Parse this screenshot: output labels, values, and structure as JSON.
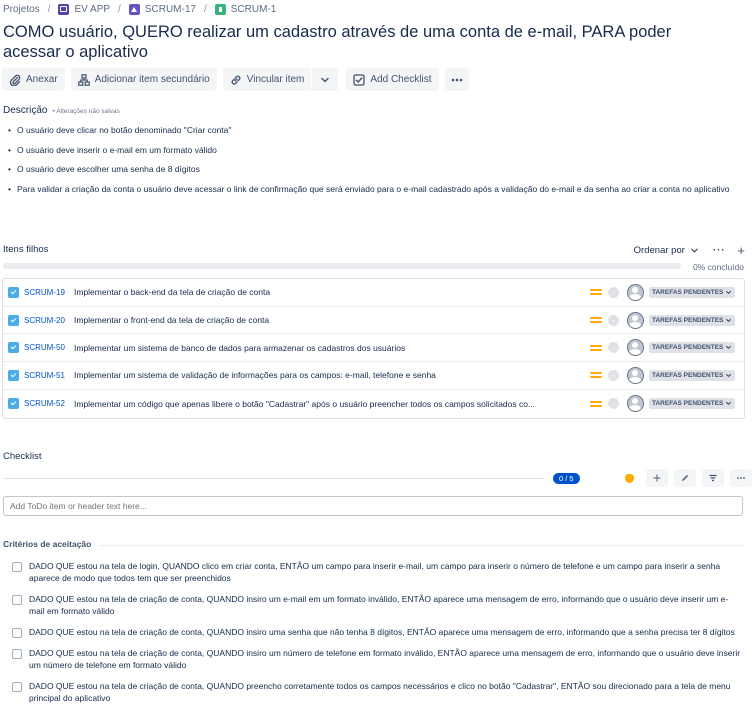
{
  "breadcrumb": {
    "root": "Projetos",
    "project": "EV APP",
    "parent": "SCRUM-17",
    "current": "SCRUM-1"
  },
  "title": "COMO usuário, QUERO realizar um cadastro através de uma conta de e-mail, PARA poder acessar o aplicativo",
  "toolbar": {
    "attach": "Anexar",
    "add_child": "Adicionar item secundário",
    "link": "Vincular item",
    "add_checklist": "Add Checklist"
  },
  "description": {
    "label": "Descrição",
    "unsaved": "• Alterações não salvas",
    "items": [
      "O usuário deve clicar no botão denominado \"Criar conta\"",
      "O usuário deve inserir o e-mail em um formato válido",
      "O usuário deve escolher uma senha de 8 dígitos",
      "Para validar a criação da conta o usuário deve acessar o link de confirmação que será enviado para o e-mail cadastrado após a validação do e-mail e da senha ao criar a conta no aplicativo"
    ]
  },
  "child_issues": {
    "label": "Itens filhos",
    "order_by": "Ordenar por",
    "progress_text": "0% concluído",
    "progress": 0,
    "status_label": "TAREFAS PENDENTES",
    "items": [
      {
        "key": "SCRUM-19",
        "summary": "Implementar o back-end da tela de criação de conta"
      },
      {
        "key": "SCRUM-20",
        "summary": "Implementar o front-end da tela de criação de conta"
      },
      {
        "key": "SCRUM-50",
        "summary": "Implementar um sistema de banco de dados para armazenar os cadastros dos usuários"
      },
      {
        "key": "SCRUM-51",
        "summary": "Implementar um sistema de validação de informações para os campos: e-mail, telefone e senha"
      },
      {
        "key": "SCRUM-52",
        "summary": "Implementar um código que apenas libere o botão \"Cadastrar\" após o usuário preencher todos os campos solicitados co..."
      }
    ],
    "estimate_placeholder": "-"
  },
  "checklist": {
    "label": "Checklist",
    "count": "0 / 5",
    "input_placeholder": "Add ToDo item or header text here...",
    "section_header": "Critérios de aceitação",
    "items": [
      "DADO QUE estou na tela de login, QUANDO clico em criar conta, ENTÃO um campo para inserir e-mail, um campo para inserir o número de telefone e um campo para inserir a senha aparece de modo que todos tem que ser preenchidos",
      "DADO QUE estou na tela de criação de conta, QUANDO insiro um e-mail em um formato inválido, ENTÃO aparece uma mensagem de erro, informando que o usuário deve inserir um e-mail em formato válido",
      "DADO QUE estou na tela de criação de conta, QUANDO insiro uma senha que não tenha 8 dígitos, ENTÃO aparece uma mensagem de erro, informando que a senha precisa ter 8 dígitos",
      "DADO QUE estou na tela de criação de conta, QUANDO insiro um número de telefone em formato inválido, ENTÃO aparece uma mensagem de erro, informando que o usuário deve inserir um número de telefone em formato válido",
      "DADO QUE estou na tela de criação de conta, QUANDO preencho corretamente todos os campos necessários e clico no botão \"Cadastrar\", ENTÃO sou direcionado para a tela de menu principal do aplicativo"
    ]
  },
  "colors": {
    "accent": "#0052cc",
    "priority": "#ffab00",
    "task": "#4bade8",
    "story": "#36b37e"
  }
}
